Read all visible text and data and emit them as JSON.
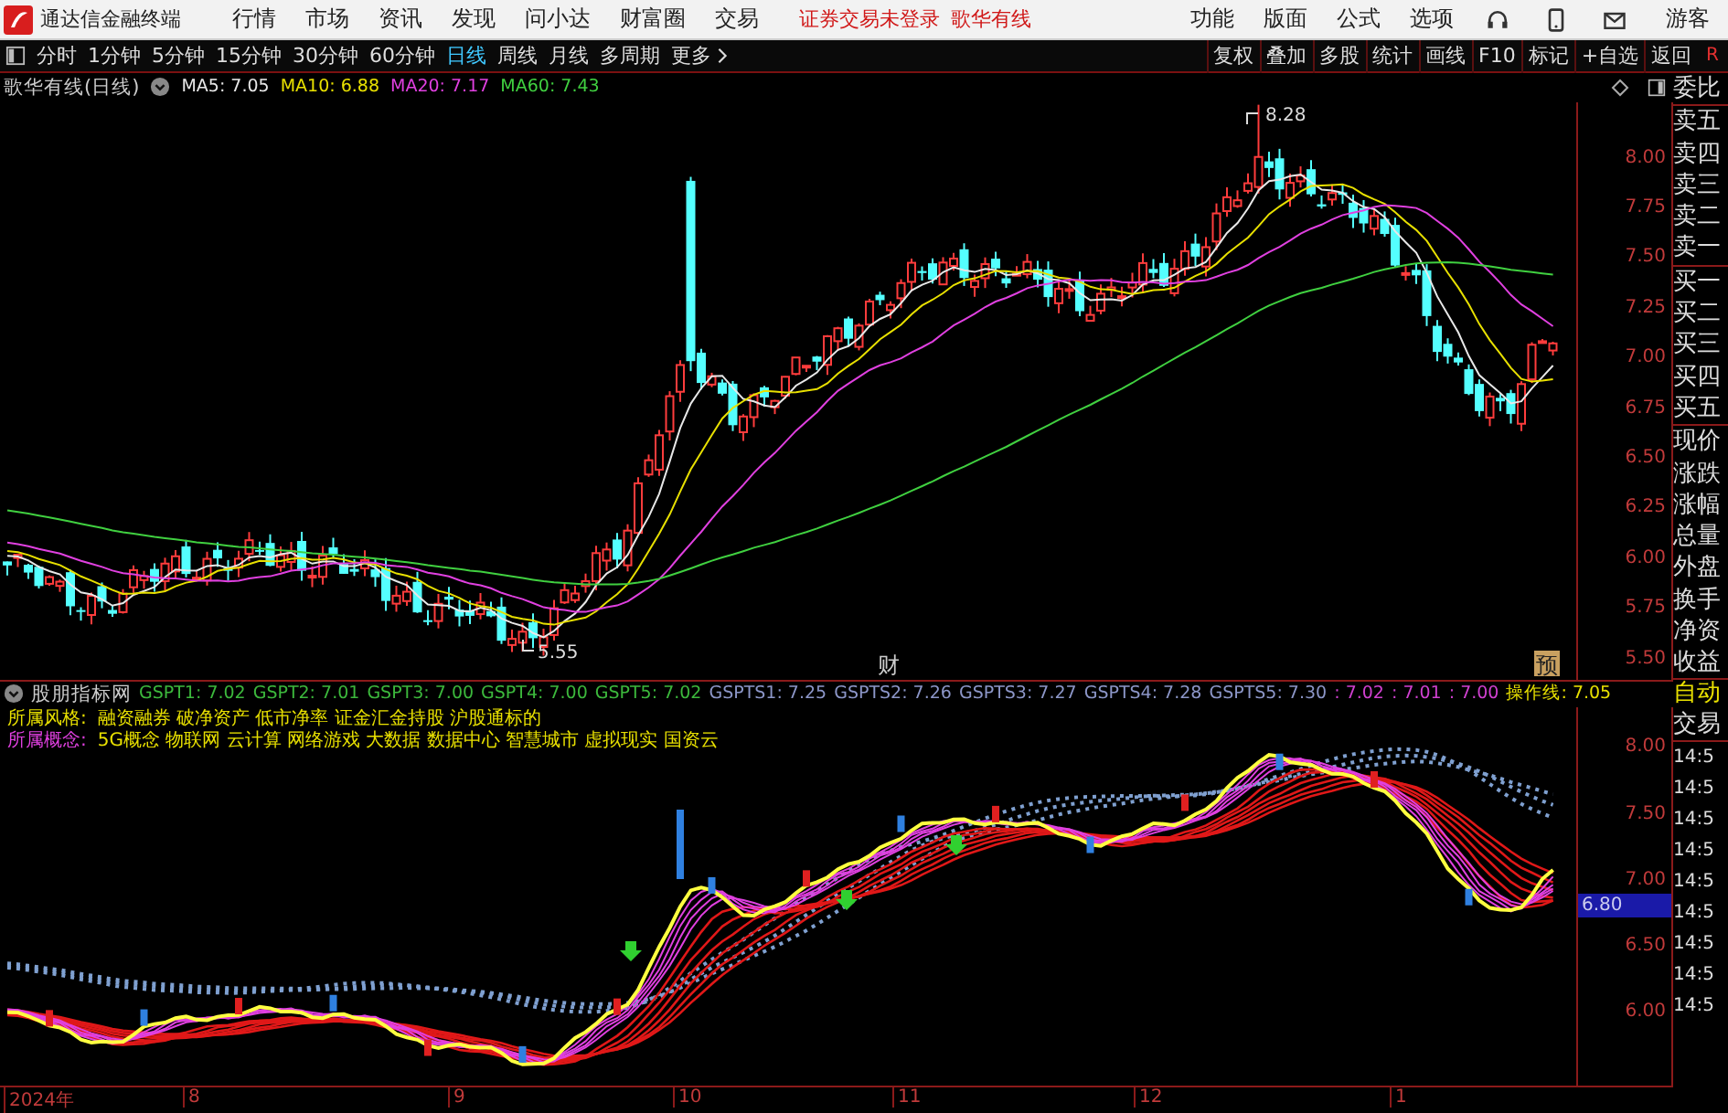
{
  "title_bar": {
    "app_name": "通达信金融终端",
    "menu": [
      "行情",
      "市场",
      "资讯",
      "发现",
      "问小达",
      "财富圈",
      "交易"
    ],
    "notice": "证券交易未登录",
    "stock": "歌华有线",
    "tools": [
      "功能",
      "版面",
      "公式",
      "选项"
    ],
    "user": "游客"
  },
  "toolbar": {
    "periods": [
      {
        "label": "分时",
        "selected": false
      },
      {
        "label": "1分钟",
        "selected": false
      },
      {
        "label": "5分钟",
        "selected": false
      },
      {
        "label": "15分钟",
        "selected": false
      },
      {
        "label": "30分钟",
        "selected": false
      },
      {
        "label": "60分钟",
        "selected": false
      },
      {
        "label": "日线",
        "selected": true
      },
      {
        "label": "周线",
        "selected": false
      },
      {
        "label": "月线",
        "selected": false
      },
      {
        "label": "多周期",
        "selected": false
      }
    ],
    "more": "更多",
    "actions": [
      "复权",
      "叠加",
      "多股",
      "统计",
      "画线",
      "F10",
      "标记",
      "+自选",
      "返回"
    ],
    "corner": "R"
  },
  "main_chart": {
    "title": "歌华有线(日线)",
    "indicators": [
      {
        "label": "MA5: 7.05",
        "color": "#e8e8e8"
      },
      {
        "label": "MA10: 6.88",
        "color": "#e8e000"
      },
      {
        "label": "MA20: 7.17",
        "color": "#e040e0"
      },
      {
        "label": "MA60: 7.43",
        "color": "#40d040"
      }
    ],
    "price_axis": [
      "8.00",
      "7.75",
      "7.50",
      "7.25",
      "7.00",
      "6.75",
      "6.50",
      "6.25",
      "6.00",
      "5.75",
      "5.50"
    ],
    "high_label": "8.28",
    "low_label": "5.55",
    "markers": [
      {
        "label": "财",
        "kind": "plain"
      },
      {
        "label": "预",
        "kind": "boxed"
      }
    ]
  },
  "indicator_panel": {
    "title": "股朋指标网",
    "values": [
      {
        "label": "GSPT1: 7.02",
        "color": "#3cb83c"
      },
      {
        "label": "GSPT2: 7.01",
        "color": "#3cb83c"
      },
      {
        "label": "GSPT3: 7.00",
        "color": "#3cb83c"
      },
      {
        "label": "GSPT4: 7.00",
        "color": "#3cb83c"
      },
      {
        "label": "GSPT5: 7.02",
        "color": "#3cb83c"
      },
      {
        "label": "GSPTS1: 7.25",
        "color": "#8c96c8"
      },
      {
        "label": "GSPTS2: 7.26",
        "color": "#8c96c8"
      },
      {
        "label": "GSPTS3: 7.27",
        "color": "#8c96c8"
      },
      {
        "label": "GSPTS4: 7.28",
        "color": "#8c96c8"
      },
      {
        "label": "GSPTS5: 7.30",
        "color": "#8c96c8"
      },
      {
        "label": ": 7.02",
        "color": "#d040d0"
      },
      {
        "label": ": 7.01",
        "color": "#d040d0"
      },
      {
        "label": ": 7.00",
        "color": "#d040d0"
      },
      {
        "label": "操作线: 7.05",
        "color": "#e8e000"
      }
    ],
    "style_label": "所属风格:",
    "style_text": "融资融券 破净资产 低市净率 证金汇金持股 沪股通标的",
    "concept_label": "所属概念:",
    "concept_text": "5G概念 物联网 云计算 网络游戏 大数据 数据中心 智慧城市 虚拟现实 国资云",
    "price_axis": [
      "8.00",
      "7.50",
      "7.00",
      "6.50",
      "6.00"
    ],
    "current": "6.80"
  },
  "date_axis": [
    "2024年",
    "8",
    "9",
    "10",
    "11",
    "12",
    "1"
  ],
  "quote_panel": {
    "items": [
      "委比",
      "卖五",
      "卖四",
      "卖三",
      "卖二",
      "卖一",
      "买一",
      "买二",
      "买三",
      "买四",
      "买五",
      "现价",
      "涨跌",
      "涨幅",
      "总量",
      "外盘",
      "换手",
      "净资",
      "收益"
    ],
    "lower_items": [
      "自动",
      "交易",
      "14:5",
      "14:5",
      "14:5",
      "14:5",
      "14:5",
      "14:5",
      "14:5",
      "14:5",
      "14:5"
    ]
  }
}
